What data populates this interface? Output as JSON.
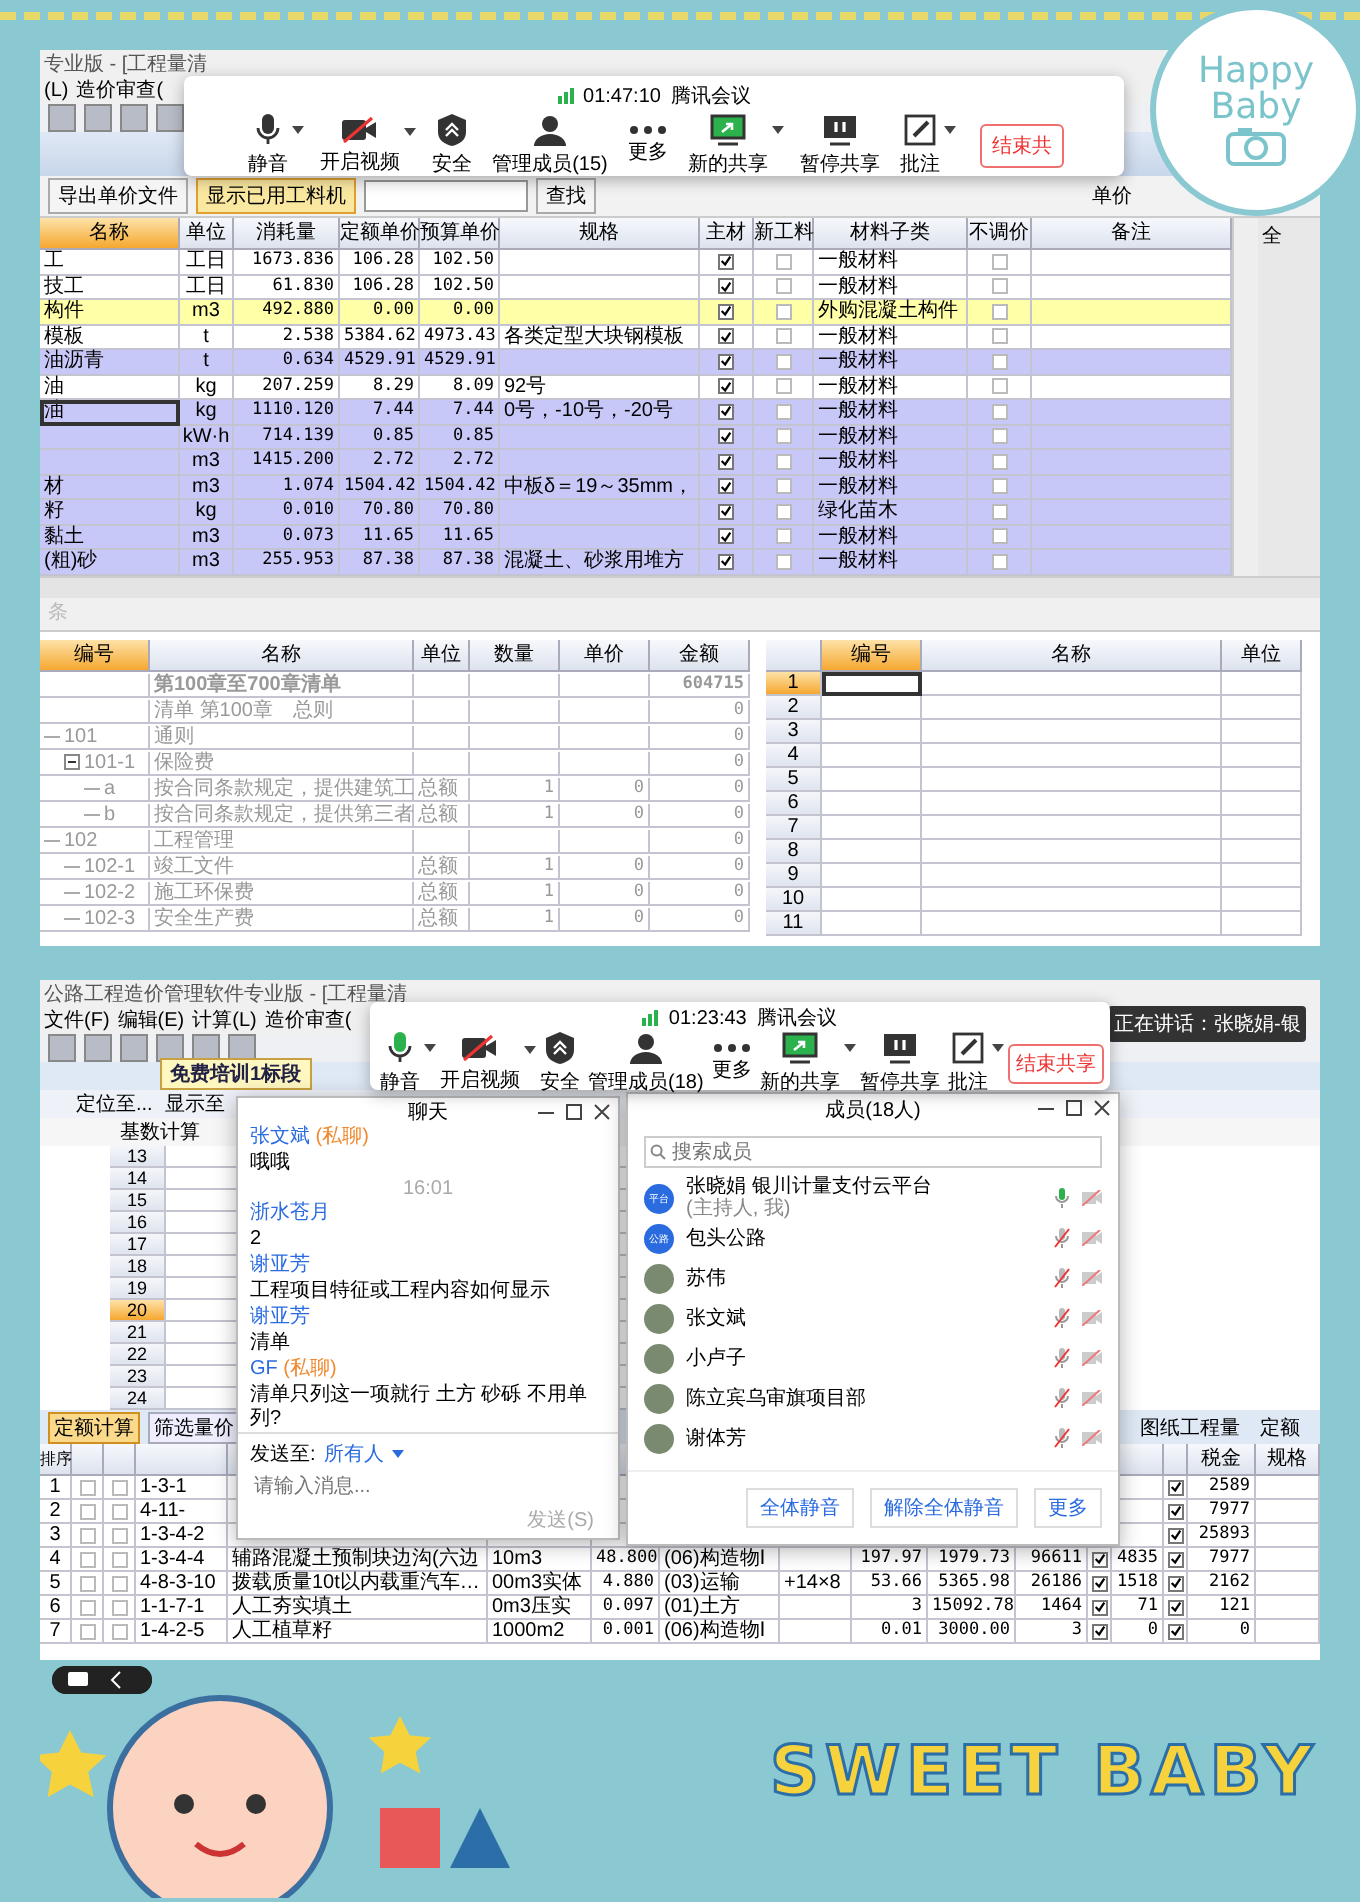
{
  "frame": {
    "badge_lines": [
      "Happy",
      "Baby"
    ],
    "banner": "SWEET BABY"
  },
  "top": {
    "app_title": "专业版 - [工程量清",
    "menu": [
      "(L)",
      "造价审查("
    ],
    "meeting": {
      "time": "01:47:10",
      "title": "腾讯会议",
      "buttons": [
        {
          "label": "静音",
          "menu": true
        },
        {
          "label": "开启视频",
          "menu": true
        },
        {
          "label": "安全",
          "menu": false
        },
        {
          "label": "管理成员(15)",
          "menu": false
        },
        {
          "label": "更多",
          "menu": false
        },
        {
          "label": "新的共享",
          "menu": true
        },
        {
          "label": "暂停共享",
          "menu": false
        },
        {
          "label": "批注",
          "menu": true
        }
      ],
      "end_button": "结束共"
    },
    "toolbar": {
      "export_button": "导出单价文件",
      "used_button": {
        "label": "显示已用工料机",
        "selected": true
      },
      "search_button": "查找",
      "right_label": "单价"
    },
    "materials": {
      "columns": [
        "名称",
        "单位",
        "消耗量",
        "定额单价",
        "预算单价",
        "规格",
        "主材",
        "新工料",
        "材料子类",
        "不调价",
        "备注"
      ],
      "side_fragment": "全",
      "rows": [
        {
          "name": "工",
          "unit": "工日",
          "qty": "1673.836",
          "quota_price": "106.28",
          "budget_price": "102.50",
          "spec": "",
          "main": true,
          "new": false,
          "subtype": "一般材料",
          "fixed": false,
          "color": "#ffffff",
          "selected": false
        },
        {
          "name": "技工",
          "unit": "工日",
          "qty": "61.830",
          "quota_price": "106.28",
          "budget_price": "102.50",
          "spec": "",
          "main": true,
          "new": false,
          "subtype": "一般材料",
          "fixed": false,
          "color": "#ffffff",
          "selected": false
        },
        {
          "name": "构件",
          "unit": "m3",
          "qty": "492.880",
          "quota_price": "0.00",
          "budget_price": "0.00",
          "spec": "",
          "main": true,
          "new": false,
          "subtype": "外购混凝土构件",
          "fixed": false,
          "color": "#ffffa8",
          "selected": false
        },
        {
          "name": "模板",
          "unit": "t",
          "qty": "2.538",
          "quota_price": "5384.62",
          "budget_price": "4973.43",
          "spec": "各类定型大块钢模板",
          "main": true,
          "new": false,
          "subtype": "一般材料",
          "fixed": false,
          "color": "#ffffff",
          "selected": false
        },
        {
          "name": "油沥青",
          "unit": "t",
          "qty": "0.634",
          "quota_price": "4529.91",
          "budget_price": "4529.91",
          "spec": "",
          "main": true,
          "new": false,
          "subtype": "一般材料",
          "fixed": false,
          "color": "#c8c8f8",
          "selected": false
        },
        {
          "name": "油",
          "unit": "kg",
          "qty": "207.259",
          "quota_price": "8.29",
          "budget_price": "8.09",
          "spec": "92号",
          "main": true,
          "new": false,
          "subtype": "一般材料",
          "fixed": false,
          "color": "#ffffff",
          "selected": false
        },
        {
          "name": "油",
          "unit": "kg",
          "qty": "1110.120",
          "quota_price": "7.44",
          "budget_price": "7.44",
          "spec": "0号，-10号，-20号",
          "main": true,
          "new": false,
          "subtype": "一般材料",
          "fixed": false,
          "color": "#c8c8f8",
          "selected": true
        },
        {
          "name": "",
          "unit": "kW·h",
          "qty": "714.139",
          "quota_price": "0.85",
          "budget_price": "0.85",
          "spec": "",
          "main": true,
          "new": false,
          "subtype": "一般材料",
          "fixed": false,
          "color": "#c8c8f8",
          "selected": false
        },
        {
          "name": "",
          "unit": "m3",
          "qty": "1415.200",
          "quota_price": "2.72",
          "budget_price": "2.72",
          "spec": "",
          "main": true,
          "new": false,
          "subtype": "一般材料",
          "fixed": false,
          "color": "#c8c8f8",
          "selected": false
        },
        {
          "name": "材",
          "unit": "m3",
          "qty": "1.074",
          "quota_price": "1504.42",
          "budget_price": "1504.42",
          "spec": "中板δ＝19～35mm，",
          "main": true,
          "new": false,
          "subtype": "一般材料",
          "fixed": false,
          "color": "#c8c8f8",
          "selected": false
        },
        {
          "name": "籽",
          "unit": "kg",
          "qty": "0.010",
          "quota_price": "70.80",
          "budget_price": "70.80",
          "spec": "",
          "main": true,
          "new": false,
          "subtype": "绿化苗木",
          "fixed": false,
          "color": "#c8c8f8",
          "selected": false
        },
        {
          "name": "黏土",
          "unit": "m3",
          "qty": "0.073",
          "quota_price": "11.65",
          "budget_price": "11.65",
          "spec": "",
          "main": true,
          "new": false,
          "subtype": "一般材料",
          "fixed": false,
          "color": "#c8c8f8",
          "selected": false
        },
        {
          "name": "(粗)砂",
          "unit": "m3",
          "qty": "255.953",
          "quota_price": "87.38",
          "budget_price": "87.38",
          "spec": "混凝土、砂浆用堆方",
          "main": true,
          "new": false,
          "subtype": "一般材料",
          "fixed": false,
          "color": "#c8c8f8",
          "selected": false
        }
      ]
    },
    "strip_label": "条",
    "bill": {
      "columns": [
        "编号",
        "名称",
        "单位",
        "数量",
        "单价",
        "金额"
      ],
      "rows": [
        {
          "name": "第100章至700章清单",
          "amount": "604715",
          "expanded": false,
          "children": [
            {
              "name": "清单 第100章　总则",
              "amount": "0",
              "expanded": false,
              "children": [
                {
                  "code": "101",
                  "name": "通则",
                  "amount": "0",
                  "expanded": false,
                  "children": [
                    {
                      "code": "101-1",
                      "name": "保险费",
                      "amount": "0",
                      "expanded": true,
                      "children": [
                        {
                          "code": "a",
                          "name": "按合同条款规定，提供建筑工",
                          "unit": "总额",
                          "qty": "1",
                          "price": "0",
                          "amount": "0",
                          "expanded": false
                        },
                        {
                          "code": "b",
                          "name": "按合同条款规定，提供第三者",
                          "unit": "总额",
                          "qty": "1",
                          "price": "0",
                          "amount": "0",
                          "expanded": false
                        }
                      ]
                    }
                  ]
                },
                {
                  "code": "102",
                  "name": "工程管理",
                  "amount": "0",
                  "expanded": false,
                  "children": [
                    {
                      "code": "102-1",
                      "name": "竣工文件",
                      "unit": "总额",
                      "qty": "1",
                      "price": "0",
                      "amount": "0",
                      "expanded": false
                    },
                    {
                      "code": "102-2",
                      "name": "施工环保费",
                      "unit": "总额",
                      "qty": "1",
                      "price": "0",
                      "amount": "0",
                      "expanded": false
                    },
                    {
                      "code": "102-3",
                      "name": "安全生产费",
                      "unit": "总额",
                      "qty": "1",
                      "price": "0",
                      "amount": "0",
                      "expanded": false
                    }
                  ]
                }
              ]
            }
          ]
        }
      ]
    },
    "side_table": {
      "columns": [
        "编号",
        "名称",
        "单位"
      ],
      "rows": [
        {
          "number": "1",
          "selected": true
        },
        {
          "number": "2",
          "selected": false
        },
        {
          "number": "3",
          "selected": false
        },
        {
          "number": "4",
          "selected": false
        },
        {
          "number": "5",
          "selected": false
        },
        {
          "number": "6",
          "selected": false
        },
        {
          "number": "7",
          "selected": false
        },
        {
          "number": "8",
          "selected": false
        },
        {
          "number": "9",
          "selected": false
        },
        {
          "number": "10",
          "selected": false
        },
        {
          "number": "11",
          "selected": false
        }
      ]
    }
  },
  "bottom": {
    "app_title": "公路工程造价管理软件专业版 - [工程量清",
    "menu": [
      "文件(F)",
      "编辑(E)",
      "计算(L)",
      "造价审查("
    ],
    "meeting": {
      "time": "01:23:43",
      "title": "腾讯会议",
      "buttons": [
        {
          "label": "静音",
          "menu": true
        },
        {
          "label": "开启视频",
          "menu": true
        },
        {
          "label": "安全",
          "menu": false
        },
        {
          "label": "管理成员(18)",
          "menu": false
        },
        {
          "label": "更多",
          "menu": false
        },
        {
          "label": "新的共享",
          "menu": true
        },
        {
          "label": "暂停共享",
          "menu": false
        },
        {
          "label": "批注",
          "menu": true
        }
      ],
      "end_button": "结束共享",
      "speaking": "正在讲话：张晓娟-银"
    },
    "doc_tab": "免费培训1标段",
    "toolbar": [
      "定位至...",
      "显示至"
    ],
    "action_button": "基数计算",
    "grid_rows": [
      {
        "number": "13",
        "selected": false
      },
      {
        "number": "14",
        "selected": false
      },
      {
        "number": "15",
        "selected": false
      },
      {
        "number": "16",
        "selected": false
      },
      {
        "number": "17",
        "selected": false
      },
      {
        "number": "18",
        "selected": false
      },
      {
        "number": "19",
        "selected": false
      },
      {
        "number": "20",
        "selected": true
      },
      {
        "number": "21",
        "selected": false
      },
      {
        "number": "22",
        "selected": false
      },
      {
        "number": "23",
        "selected": false
      },
      {
        "number": "24",
        "selected": false
      }
    ],
    "lower_tabs": [
      {
        "label": "定额计算",
        "selected": true
      },
      {
        "label": "筛选量价",
        "selected": false
      }
    ],
    "right_tools": [
      "图纸工程量",
      "定额"
    ],
    "table": {
      "columns": [
        "排序",
        "税金",
        "规格"
      ],
      "rows": [
        {
          "seq": "1",
          "code": "1-3-1",
          "name": "",
          "unit": "",
          "qty": "",
          "type": "",
          "spec": "",
          "p1": "",
          "p2": "",
          "total": "",
          "v2": "",
          "tax": "2589",
          "lock1": false,
          "lock2": false,
          "check_b": true
        },
        {
          "seq": "2",
          "code": "4-11-",
          "name": "",
          "unit": "",
          "qty": "",
          "type": "",
          "spec": "",
          "p1": "",
          "p2": "",
          "total": "",
          "v2": "",
          "tax": "7977",
          "lock1": false,
          "lock2": false,
          "check_b": true
        },
        {
          "seq": "3",
          "code": "1-3-4-2",
          "name": "",
          "unit": "",
          "qty": "",
          "type": "",
          "spec": "",
          "p1": "",
          "p2": "",
          "total": "",
          "v2": "",
          "tax": "25893",
          "lock1": false,
          "lock2": false,
          "check_b": true
        },
        {
          "seq": "4",
          "code": "1-3-4-4",
          "name": "辅路混凝土预制块边沟(六边",
          "unit": "10m3",
          "qty": "48.800",
          "type": "(06)构造物Ⅰ",
          "spec": "",
          "p1": "197.97",
          "p2": "1979.73",
          "total": "96611",
          "v2": "4835",
          "tax": "7977",
          "lock1": false,
          "lock2": false,
          "check_a": true,
          "check_b": true
        },
        {
          "seq": "5",
          "code": "4-8-3-10",
          "name": "拨载质量10t以内载重汽车…",
          "unit": "00m3实体",
          "qty": "4.880",
          "type": "(03)运输",
          "spec": "+14×8",
          "p1": "53.66",
          "p2": "5365.98",
          "total": "26186",
          "v2": "1518",
          "tax": "2162",
          "lock1": false,
          "lock2": false,
          "check_a": true,
          "check_b": true
        },
        {
          "seq": "6",
          "code": "1-1-7-1",
          "name": "人工夯实填土",
          "unit": "0m3压实",
          "qty": "0.097",
          "type": "(01)土方",
          "spec": "",
          "p1": "3",
          "p2": "15092.78",
          "total": "1464",
          "v2": "71",
          "tax": "121",
          "lock1": false,
          "lock2": false,
          "check_a": true,
          "check_b": true
        },
        {
          "seq": "7",
          "code": "1-4-2-5",
          "name": "人工植草籽",
          "unit": "1000m2",
          "qty": "0.001",
          "type": "(06)构造物Ⅰ",
          "spec": "",
          "p1": "0.01",
          "p2": "3000.00",
          "total": "3",
          "v2": "0",
          "tax": "0",
          "lock1": false,
          "lock2": false,
          "check_a": true,
          "check_b": true
        }
      ]
    },
    "chat": {
      "title": "聊天",
      "messages": [
        {
          "kind": "message",
          "sender": "张文斌",
          "private": "(私聊)",
          "text": "哦哦"
        },
        {
          "kind": "time",
          "text": "16:01"
        },
        {
          "kind": "message",
          "sender": "浙水苍月",
          "text": "2"
        },
        {
          "kind": "message",
          "sender": "谢亚芳",
          "text": "工程项目特征或工程内容如何显示"
        },
        {
          "kind": "message",
          "sender": "谢亚芳",
          "text": "清单"
        },
        {
          "kind": "message",
          "sender": "GF",
          "private": "(私聊)",
          "text": "清单只列这一项就行 土方 砂砾 不用单列?"
        }
      ],
      "send_to_label": "发送至:",
      "send_to": "所有人",
      "placeholder": "请输入消息...",
      "send_button": "发送(S)"
    },
    "members": {
      "title": "成员(18人)",
      "search_placeholder": "搜索成员",
      "list": [
        {
          "name": "张晓娟 银川计量支付云平台",
          "note": "(主持人, 我)",
          "kind": "text",
          "avatar_text": "平台",
          "muted": false
        },
        {
          "name": "包头公路",
          "kind": "text",
          "avatar_text": "公路",
          "muted": true
        },
        {
          "name": "苏伟",
          "kind": "photo",
          "muted": true
        },
        {
          "name": "张文斌",
          "kind": "photo",
          "muted": true
        },
        {
          "name": "小卢子",
          "kind": "photo",
          "muted": true
        },
        {
          "name": "陈立宾乌审旗项目部",
          "kind": "photo",
          "muted": true
        },
        {
          "name": "谢体芳",
          "kind": "photo",
          "muted": true
        }
      ],
      "buttons": [
        "全体静音",
        "解除全体静音",
        "更多"
      ]
    }
  }
}
